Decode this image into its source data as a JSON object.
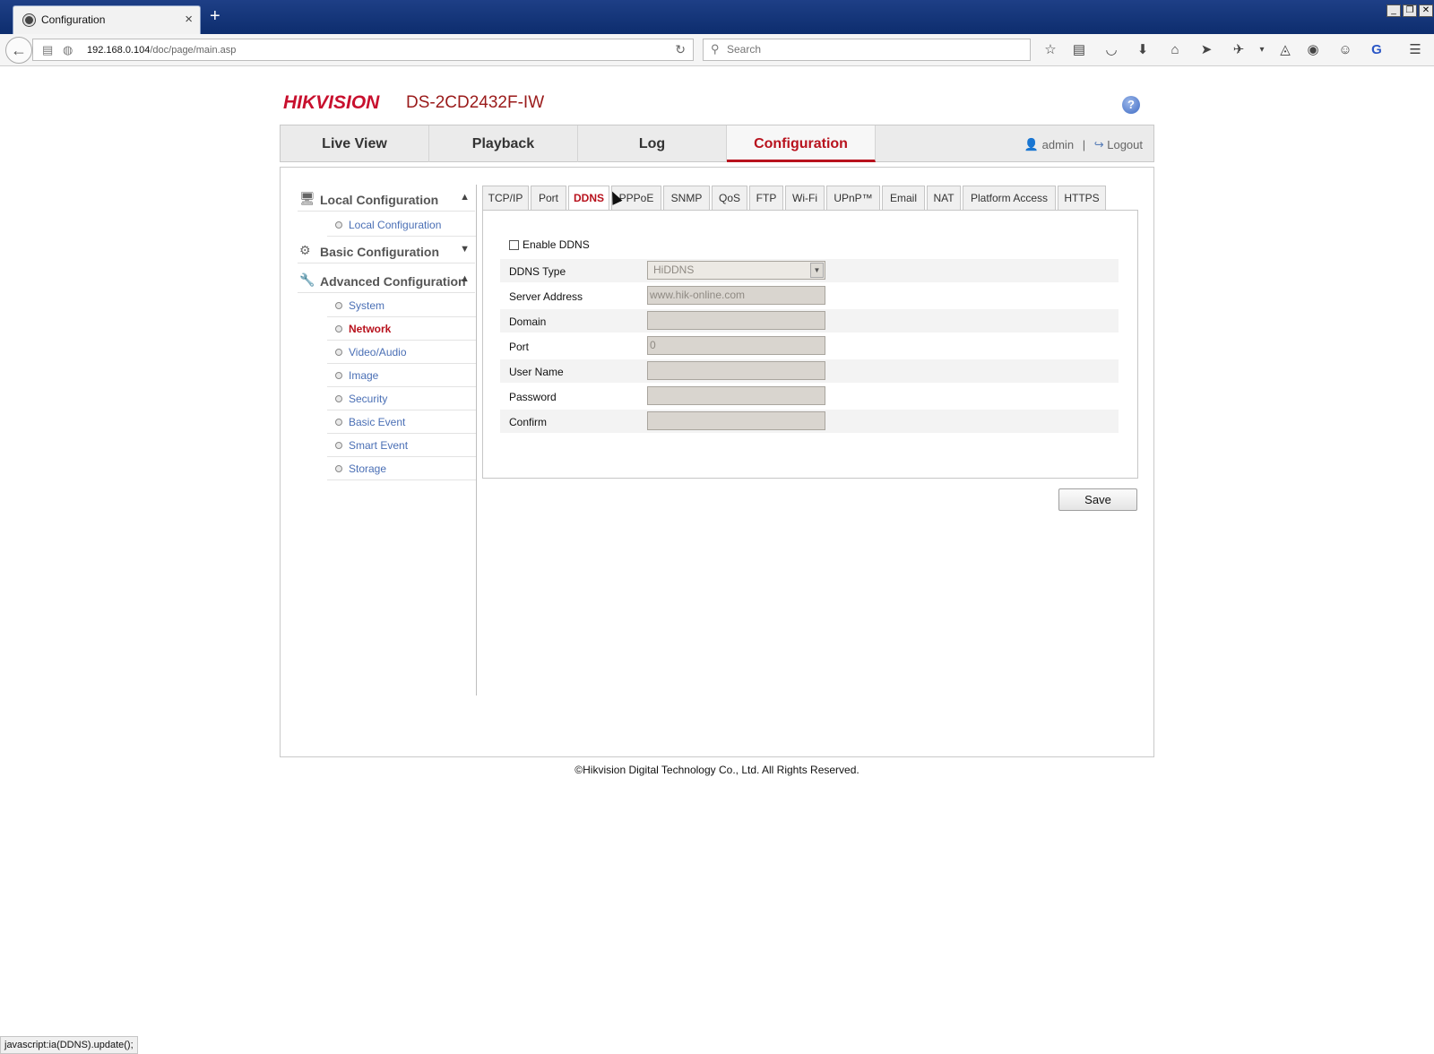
{
  "browser": {
    "tab_title": "Configuration",
    "tab_close": "×",
    "new_tab": "+",
    "window_controls": [
      "_",
      "❐",
      "✕"
    ],
    "url_host": "192.168.0.104",
    "url_path": "/doc/page/main.asp",
    "search_placeholder": "Search",
    "toolbar_icons": [
      "star-icon",
      "reading-list-icon",
      "pocket-icon",
      "download-icon",
      "home-icon",
      "send-icon",
      "extension-icon",
      "dropdown-icon",
      "sync-icon",
      "history-icon",
      "chat-icon",
      "google-icon",
      "menu-icon"
    ],
    "status_text": "javascript:ia(DDNS).update();"
  },
  "header": {
    "logo": "HIKVISION",
    "model": "DS-2CD2432F-IW",
    "help": "?"
  },
  "main_tabs": [
    {
      "label": "Live View"
    },
    {
      "label": "Playback"
    },
    {
      "label": "Log"
    },
    {
      "label": "Configuration",
      "active": true
    }
  ],
  "user": {
    "name": "admin",
    "separator": "|",
    "logout": "Logout"
  },
  "sidebar": {
    "sections": [
      {
        "label": "Local Configuration",
        "expanded": true,
        "items": [
          {
            "label": "Local Configuration"
          }
        ]
      },
      {
        "label": "Basic Configuration",
        "expanded": false,
        "items": []
      },
      {
        "label": "Advanced Configuration",
        "expanded": true,
        "items": [
          {
            "label": "System"
          },
          {
            "label": "Network",
            "active": true
          },
          {
            "label": "Video/Audio"
          },
          {
            "label": "Image"
          },
          {
            "label": "Security"
          },
          {
            "label": "Basic Event"
          },
          {
            "label": "Smart Event"
          },
          {
            "label": "Storage"
          }
        ]
      }
    ]
  },
  "sub_tabs": [
    {
      "label": "TCP/IP"
    },
    {
      "label": "Port"
    },
    {
      "label": "DDNS",
      "active": true
    },
    {
      "label": "PPPoE"
    },
    {
      "label": "SNMP"
    },
    {
      "label": "QoS"
    },
    {
      "label": "FTP"
    },
    {
      "label": "Wi-Fi"
    },
    {
      "label": "UPnP™"
    },
    {
      "label": "Email"
    },
    {
      "label": "NAT"
    },
    {
      "label": "Platform Access"
    },
    {
      "label": "HTTPS"
    }
  ],
  "ddns": {
    "enable_label": "Enable DDNS",
    "enabled": false,
    "fields": [
      {
        "label": "DDNS Type",
        "value": "HiDDNS",
        "type": "select"
      },
      {
        "label": "Server Address",
        "value": "www.hik-online.com"
      },
      {
        "label": "Domain",
        "value": ""
      },
      {
        "label": "Port",
        "value": "0"
      },
      {
        "label": "User Name",
        "value": ""
      },
      {
        "label": "Password",
        "value": ""
      },
      {
        "label": "Confirm",
        "value": ""
      }
    ],
    "save_label": "Save"
  },
  "footer": {
    "copyright": "©Hikvision Digital Technology Co., Ltd. All Rights Reserved."
  },
  "colors": {
    "accent": "#b8121d",
    "link": "#4a6fb5",
    "titlebar": "#1e3f86"
  }
}
